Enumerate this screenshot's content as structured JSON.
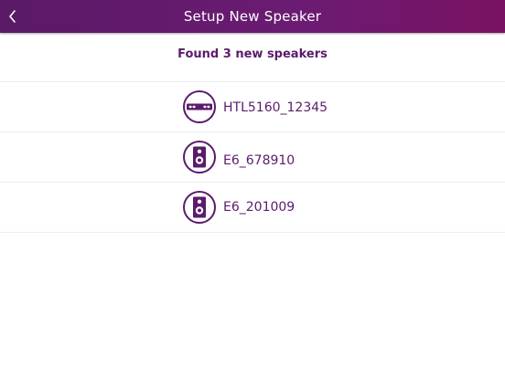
{
  "header": {
    "title": "Setup New Speaker",
    "back_icon": "chevron-left-icon"
  },
  "found_text": "Found 3 new speakers",
  "speakers": [
    {
      "name": "HTL5160_12345",
      "icon": "soundbar-icon"
    },
    {
      "name": "E6_678910",
      "icon": "speaker-icon"
    },
    {
      "name": "E6_201009",
      "icon": "speaker-icon"
    }
  ],
  "colors": {
    "brand_purple": "#5b1b6b",
    "header_gradient_start": "#5a1a66",
    "header_gradient_end": "#7a1263",
    "background": "#ffffff"
  }
}
